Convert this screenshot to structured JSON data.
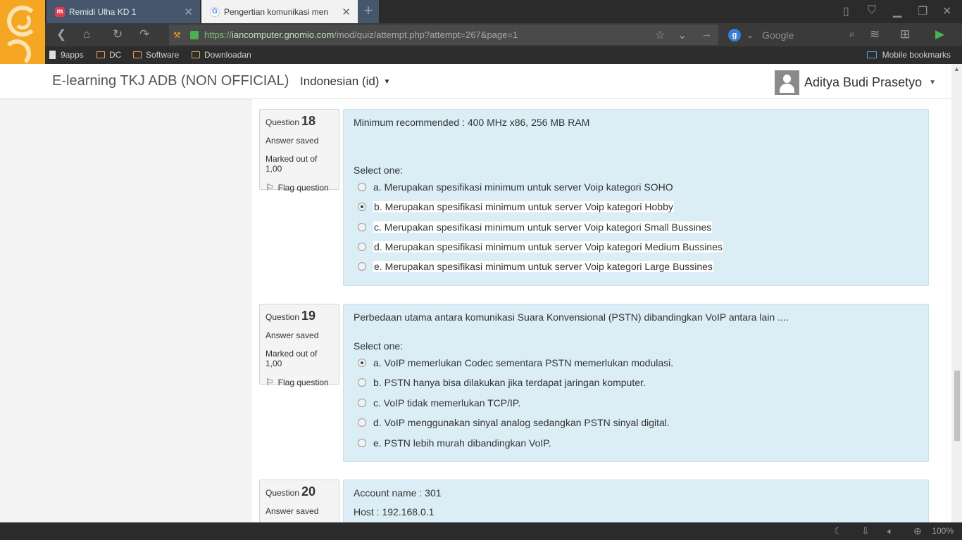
{
  "browser": {
    "tabs": [
      {
        "title": "Remidi Ulha KD 1",
        "favicon": "m"
      },
      {
        "title": "Pengertian komunikasi men",
        "favicon": "G"
      }
    ],
    "new_tab_label": "+",
    "url": {
      "scheme": "https://",
      "host": "iancomputer.gnomio.com",
      "path": "/mod/quiz/attempt.php?attempt=267&page=1"
    },
    "search": {
      "engine_letter": "g",
      "placeholder": "Google"
    },
    "bookmarks": [
      {
        "label": "9apps",
        "type": "page"
      },
      {
        "label": "DC",
        "type": "folder"
      },
      {
        "label": "Software",
        "type": "folder"
      },
      {
        "label": "Downloadan",
        "type": "folder"
      }
    ],
    "mobile_bookmarks": "Mobile bookmarks",
    "zoom": "100%"
  },
  "site": {
    "title": "E-learning TKJ ADB (NON OFFICIAL)",
    "language": "Indonesian (id)",
    "user": "Aditya Budi Prasetyo"
  },
  "labels": {
    "question": "Question",
    "select_one": "Select one:"
  },
  "questions": [
    {
      "number": "18",
      "status": "Answer saved",
      "marks": "Marked out of 1,00",
      "flag": "Flag question",
      "text": "Minimum recommended :  400 MHz x86, 256 MB RAM",
      "selected": 1,
      "options": [
        "a. Merupakan spesifikasi minimum untuk server Voip kategori SOHO",
        "b. Merupakan spesifikasi minimum untuk server Voip kategori Hobby",
        "c. Merupakan spesifikasi minimum untuk server Voip kategori Small Bussines",
        "d. Merupakan spesifikasi minimum untuk server Voip kategori Medium Bussines",
        "e. Merupakan spesifikasi minimum untuk server Voip kategori Large Bussines"
      ]
    },
    {
      "number": "19",
      "status": "Answer saved",
      "marks": "Marked out of 1,00",
      "flag": "Flag question",
      "text": "Perbedaan utama antara komunikasi Suara Konvensional (PSTN) dibandingkan VoIP antara lain ....",
      "selected": 0,
      "options": [
        "a. VoIP memerlukan Codec sementara PSTN memerlukan modulasi.",
        "b. PSTN hanya bisa dilakukan jika terdapat jaringan komputer.",
        "c. VoIP tidak memerlukan TCP/IP.",
        "d. VoIP menggunakan sinyal analog sedangkan PSTN sinyal digital.",
        "e. PSTN lebih murah dibandingkan VoIP."
      ]
    },
    {
      "number": "20",
      "status": "Answer saved",
      "lines": [
        "Account name : 301",
        "Host : 192.168.0.1"
      ]
    }
  ],
  "colors": {
    "content_bg": "#dbeef6",
    "info_bg": "#f4f4f4",
    "url_green": "#7dbf7d",
    "active_tab": "#46576d"
  }
}
